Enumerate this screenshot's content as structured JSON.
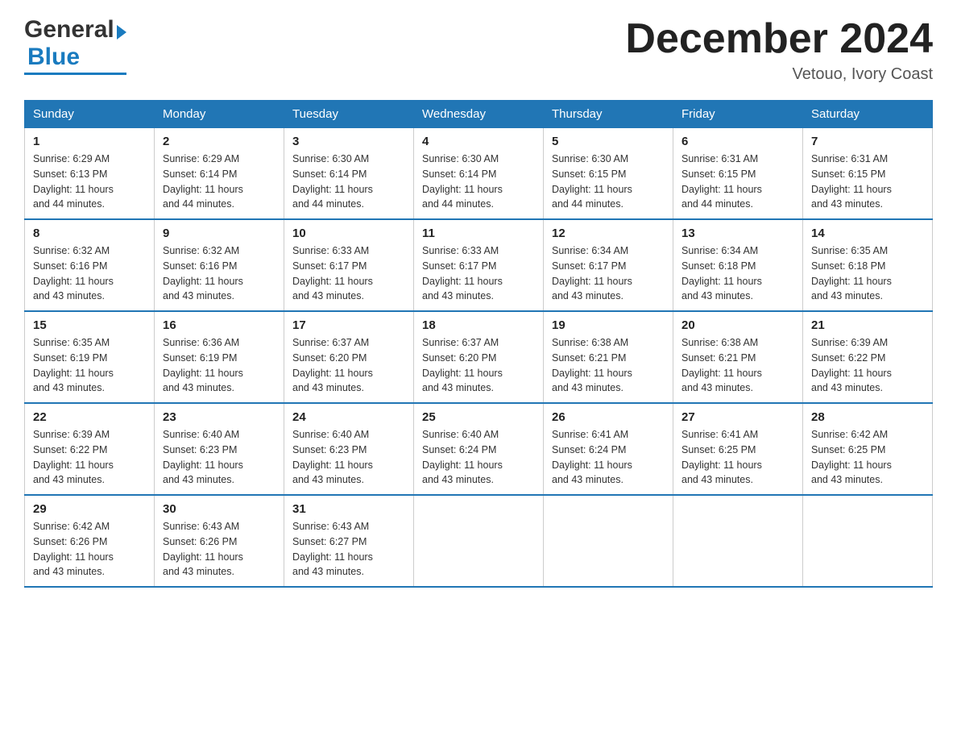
{
  "header": {
    "logo_general": "General",
    "logo_blue": "Blue",
    "month_title": "December 2024",
    "location": "Vetouo, Ivory Coast"
  },
  "weekdays": [
    "Sunday",
    "Monday",
    "Tuesday",
    "Wednesday",
    "Thursday",
    "Friday",
    "Saturday"
  ],
  "weeks": [
    [
      {
        "day": "1",
        "sunrise": "6:29 AM",
        "sunset": "6:13 PM",
        "daylight": "11 hours and 44 minutes."
      },
      {
        "day": "2",
        "sunrise": "6:29 AM",
        "sunset": "6:14 PM",
        "daylight": "11 hours and 44 minutes."
      },
      {
        "day": "3",
        "sunrise": "6:30 AM",
        "sunset": "6:14 PM",
        "daylight": "11 hours and 44 minutes."
      },
      {
        "day": "4",
        "sunrise": "6:30 AM",
        "sunset": "6:14 PM",
        "daylight": "11 hours and 44 minutes."
      },
      {
        "day": "5",
        "sunrise": "6:30 AM",
        "sunset": "6:15 PM",
        "daylight": "11 hours and 44 minutes."
      },
      {
        "day": "6",
        "sunrise": "6:31 AM",
        "sunset": "6:15 PM",
        "daylight": "11 hours and 44 minutes."
      },
      {
        "day": "7",
        "sunrise": "6:31 AM",
        "sunset": "6:15 PM",
        "daylight": "11 hours and 43 minutes."
      }
    ],
    [
      {
        "day": "8",
        "sunrise": "6:32 AM",
        "sunset": "6:16 PM",
        "daylight": "11 hours and 43 minutes."
      },
      {
        "day": "9",
        "sunrise": "6:32 AM",
        "sunset": "6:16 PM",
        "daylight": "11 hours and 43 minutes."
      },
      {
        "day": "10",
        "sunrise": "6:33 AM",
        "sunset": "6:17 PM",
        "daylight": "11 hours and 43 minutes."
      },
      {
        "day": "11",
        "sunrise": "6:33 AM",
        "sunset": "6:17 PM",
        "daylight": "11 hours and 43 minutes."
      },
      {
        "day": "12",
        "sunrise": "6:34 AM",
        "sunset": "6:17 PM",
        "daylight": "11 hours and 43 minutes."
      },
      {
        "day": "13",
        "sunrise": "6:34 AM",
        "sunset": "6:18 PM",
        "daylight": "11 hours and 43 minutes."
      },
      {
        "day": "14",
        "sunrise": "6:35 AM",
        "sunset": "6:18 PM",
        "daylight": "11 hours and 43 minutes."
      }
    ],
    [
      {
        "day": "15",
        "sunrise": "6:35 AM",
        "sunset": "6:19 PM",
        "daylight": "11 hours and 43 minutes."
      },
      {
        "day": "16",
        "sunrise": "6:36 AM",
        "sunset": "6:19 PM",
        "daylight": "11 hours and 43 minutes."
      },
      {
        "day": "17",
        "sunrise": "6:37 AM",
        "sunset": "6:20 PM",
        "daylight": "11 hours and 43 minutes."
      },
      {
        "day": "18",
        "sunrise": "6:37 AM",
        "sunset": "6:20 PM",
        "daylight": "11 hours and 43 minutes."
      },
      {
        "day": "19",
        "sunrise": "6:38 AM",
        "sunset": "6:21 PM",
        "daylight": "11 hours and 43 minutes."
      },
      {
        "day": "20",
        "sunrise": "6:38 AM",
        "sunset": "6:21 PM",
        "daylight": "11 hours and 43 minutes."
      },
      {
        "day": "21",
        "sunrise": "6:39 AM",
        "sunset": "6:22 PM",
        "daylight": "11 hours and 43 minutes."
      }
    ],
    [
      {
        "day": "22",
        "sunrise": "6:39 AM",
        "sunset": "6:22 PM",
        "daylight": "11 hours and 43 minutes."
      },
      {
        "day": "23",
        "sunrise": "6:40 AM",
        "sunset": "6:23 PM",
        "daylight": "11 hours and 43 minutes."
      },
      {
        "day": "24",
        "sunrise": "6:40 AM",
        "sunset": "6:23 PM",
        "daylight": "11 hours and 43 minutes."
      },
      {
        "day": "25",
        "sunrise": "6:40 AM",
        "sunset": "6:24 PM",
        "daylight": "11 hours and 43 minutes."
      },
      {
        "day": "26",
        "sunrise": "6:41 AM",
        "sunset": "6:24 PM",
        "daylight": "11 hours and 43 minutes."
      },
      {
        "day": "27",
        "sunrise": "6:41 AM",
        "sunset": "6:25 PM",
        "daylight": "11 hours and 43 minutes."
      },
      {
        "day": "28",
        "sunrise": "6:42 AM",
        "sunset": "6:25 PM",
        "daylight": "11 hours and 43 minutes."
      }
    ],
    [
      {
        "day": "29",
        "sunrise": "6:42 AM",
        "sunset": "6:26 PM",
        "daylight": "11 hours and 43 minutes."
      },
      {
        "day": "30",
        "sunrise": "6:43 AM",
        "sunset": "6:26 PM",
        "daylight": "11 hours and 43 minutes."
      },
      {
        "day": "31",
        "sunrise": "6:43 AM",
        "sunset": "6:27 PM",
        "daylight": "11 hours and 43 minutes."
      },
      null,
      null,
      null,
      null
    ]
  ],
  "labels": {
    "sunrise": "Sunrise:",
    "sunset": "Sunset:",
    "daylight": "Daylight:"
  }
}
